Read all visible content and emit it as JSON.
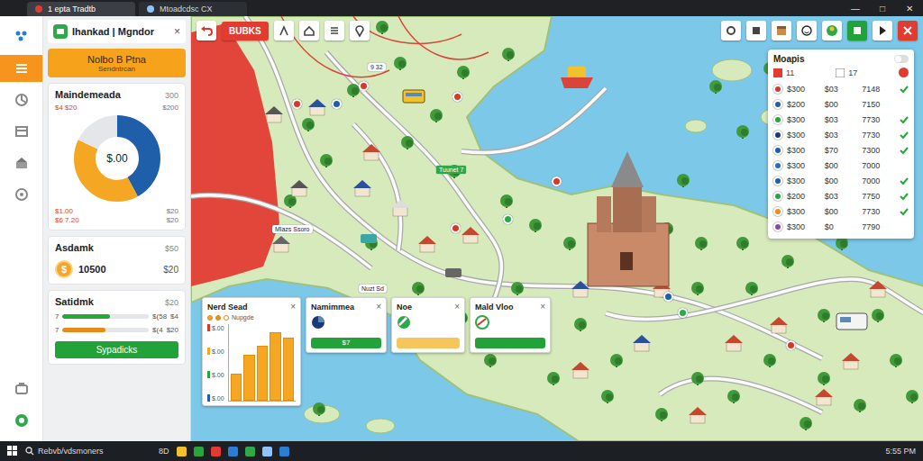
{
  "browser": {
    "tabs": [
      {
        "label": "1 epta Tradtb",
        "selected": true
      },
      {
        "label": "Mtoadcdsc CX",
        "selected": false
      }
    ],
    "controls": [
      "—",
      "□",
      "✕"
    ]
  },
  "rail": {
    "items": [
      {
        "selected": false
      },
      {
        "selected": true
      },
      {
        "selected": false
      },
      {
        "selected": false
      },
      {
        "selected": false
      },
      {
        "selected": false
      },
      {
        "selected": false
      },
      {
        "selected": false
      }
    ]
  },
  "panel": {
    "title": "Ihankad | Mgndor",
    "close": "×",
    "banner": {
      "title": "Nolbo B Ptna",
      "subtitle": "Sendntrcan"
    }
  },
  "donut_card": {
    "title": "Maindemeada",
    "value": "300",
    "center": "$.00",
    "segments": [
      {
        "value": 42,
        "color": "#1f5ea8"
      },
      {
        "value": 40,
        "color": "#f5a623"
      },
      {
        "value": 18,
        "color": "#e4e6e9"
      }
    ],
    "left_labels": [
      "$4 $20",
      "$1.00",
      "$6 7.20"
    ],
    "right_labels": [
      "$200",
      "$20",
      "$20"
    ]
  },
  "asset_card": {
    "title": "Asdamk",
    "value": "$50",
    "coin": "$",
    "amount": "10500",
    "amount_right": "$20"
  },
  "stat_card": {
    "title": "Satidmk",
    "value": "$20",
    "rows": [
      {
        "label": "7",
        "level": 0.55,
        "color": "#27a63a",
        "reading": "$(58",
        "right": "$4"
      },
      {
        "label": "7",
        "level": 0.5,
        "color": "#e88a1a",
        "reading": "$(4",
        "right": "$20"
      }
    ],
    "button": "Sypadicks"
  },
  "map_toolbar": {
    "button": "BUBKS"
  },
  "map_pins": [
    {
      "color": "#d33a2c"
    },
    {
      "color": "#d33a2c"
    },
    {
      "color": "#1f5ea8"
    },
    {
      "color": "#d33a2c"
    },
    {
      "color": "#d33a2c"
    },
    {
      "color": "#2fa84a"
    },
    {
      "color": "#d33a2c"
    },
    {
      "color": "#1f5ea8"
    },
    {
      "color": "#d33a2c"
    },
    {
      "color": "#2fa84a"
    }
  ],
  "map_labels": [
    {
      "label": "9 32",
      "kind": "plain"
    },
    {
      "label": "Tuunet 7",
      "kind": "green"
    },
    {
      "label": "Mlazs Ssoro",
      "kind": "plain"
    },
    {
      "label": "Nuzt Sd",
      "kind": "plain"
    }
  ],
  "popups": [
    {
      "kind": "chart",
      "title": "Nerd Sead",
      "close": "×",
      "legend": [
        {
          "color": "#f5a623"
        },
        {
          "color": "#f08c1a"
        },
        {
          "color": "#ffffff"
        }
      ],
      "subtitle": "Nupgde",
      "ticks": [
        {
          "label": "$.00",
          "color": "#d33a2c"
        },
        {
          "label": "$.00",
          "color": "#f5a623"
        },
        {
          "label": "$.00",
          "color": "#27a63a"
        },
        {
          "label": "$.00",
          "color": "#1f5ea8"
        }
      ],
      "values": [
        35,
        60,
        72,
        90,
        82
      ]
    },
    {
      "kind": "button",
      "title": "Namimmea",
      "close": "×",
      "button": "$7",
      "color": "#22a33a"
    },
    {
      "kind": "button",
      "title": "Noe",
      "close": "×",
      "button": "",
      "color": "#f7c65a"
    },
    {
      "kind": "button",
      "title": "Mald Vloo",
      "close": "×",
      "button": "",
      "color": "#22a33a"
    }
  ],
  "right_panel": {
    "title": "Moapis",
    "counts": [
      "11",
      "17"
    ],
    "rows": [
      {
        "c1": "$300",
        "c2": "$03",
        "c3": "7148",
        "color": "#d33a2c",
        "checked": true
      },
      {
        "c1": "$200",
        "c2": "$00",
        "c3": "7150",
        "color": "#1f5ea8",
        "checked": false
      },
      {
        "c1": "$300",
        "c2": "$03",
        "c3": "7730",
        "color": "#27a63a",
        "checked": true
      },
      {
        "c1": "$300",
        "c2": "$03",
        "c3": "7730",
        "color": "#183a7a",
        "checked": true
      },
      {
        "c1": "$300",
        "c2": "$70",
        "c3": "7300",
        "color": "#1f5ea8",
        "checked": true
      },
      {
        "c1": "$300",
        "c2": "$00",
        "c3": "7000",
        "color": "#2a6ec0",
        "checked": false
      },
      {
        "c1": "$300",
        "c2": "$00",
        "c3": "7000",
        "color": "#1f5ea8",
        "checked": true
      },
      {
        "c1": "$200",
        "c2": "$03",
        "c3": "7750",
        "color": "#27a63a",
        "checked": true
      },
      {
        "c1": "$300",
        "c2": "$00",
        "c3": "7730",
        "color": "#f08c1a",
        "checked": true
      },
      {
        "c1": "$300",
        "c2": "$0",
        "c3": "7790",
        "color": "#8e44ad",
        "checked": false
      }
    ]
  },
  "taskbar": {
    "search": "Rebvb/vdsmoners",
    "label": "8D",
    "time": "5:55 PM"
  }
}
